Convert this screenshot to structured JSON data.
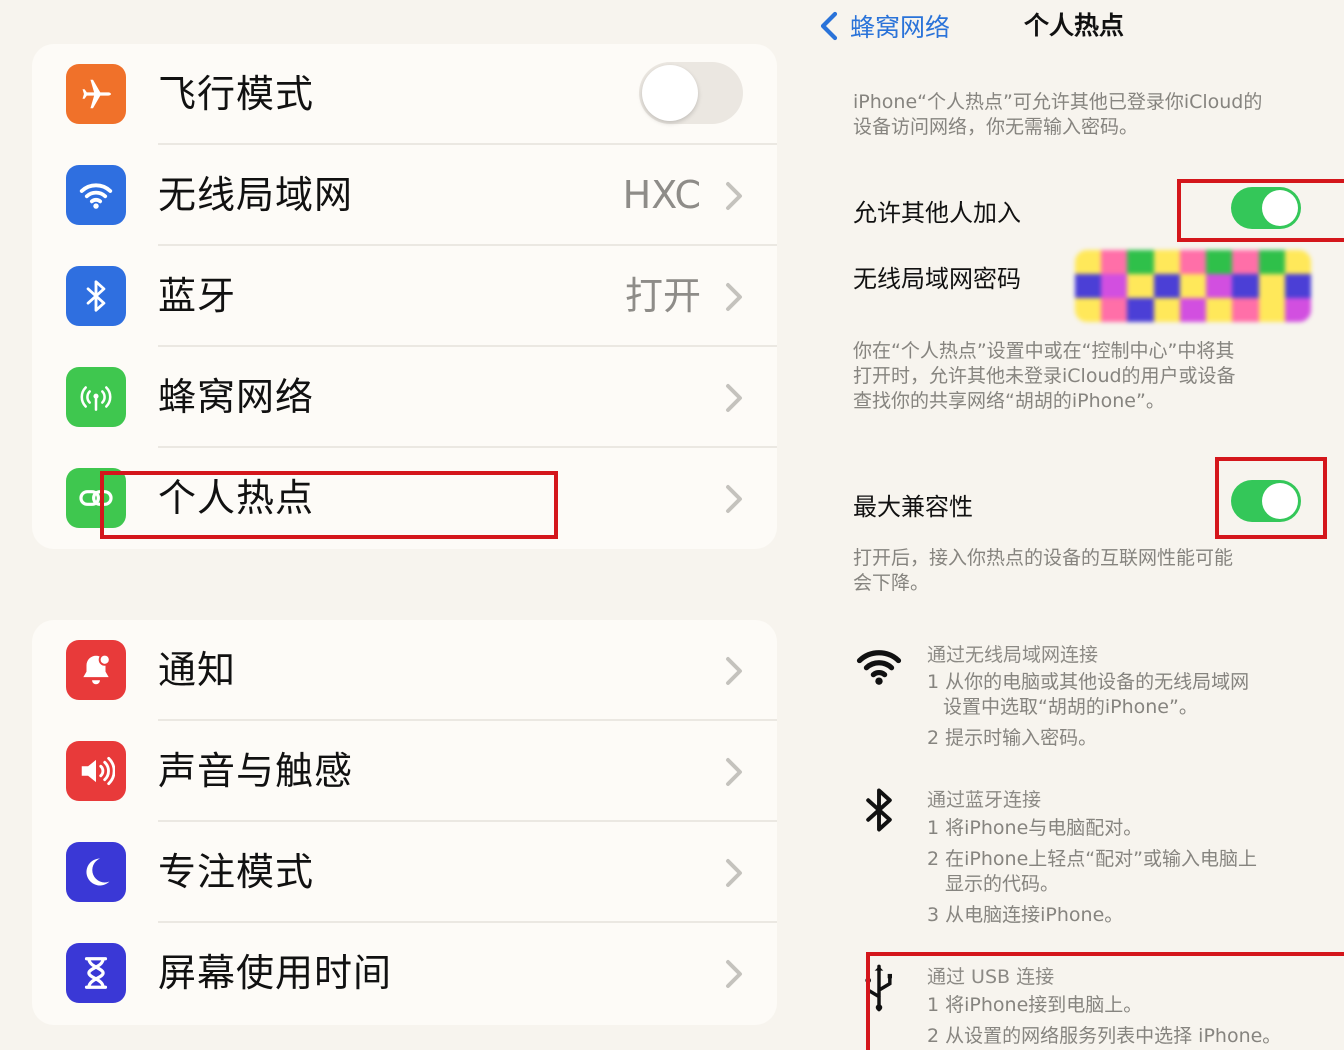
{
  "colors": {
    "airplane": "#f0712a",
    "wifi": "#2f6fe0",
    "bluetooth": "#2f6fe0",
    "cellular": "#3fc74f",
    "hotspot": "#3fc74f",
    "notifications": "#e83a3a",
    "sounds": "#e83a3a",
    "focus": "#3a38d6",
    "screentime": "#3a38d6",
    "toggle_on": "#34c759",
    "link": "#2a73d9",
    "highlight": "#d4161b"
  },
  "settings": {
    "group1": [
      {
        "label": "飞行模式",
        "icon": "airplane-icon",
        "control": "toggle-off"
      },
      {
        "label": "无线局域网",
        "icon": "wifi-icon",
        "value": "HXC"
      },
      {
        "label": "蓝牙",
        "icon": "bluetooth-icon",
        "value": "打开"
      },
      {
        "label": "蜂窝网络",
        "icon": "cellular-icon"
      },
      {
        "label": "个人热点",
        "icon": "hotspot-icon"
      }
    ],
    "group2": [
      {
        "label": "通知",
        "icon": "bell-icon"
      },
      {
        "label": "声音与触感",
        "icon": "speaker-icon"
      },
      {
        "label": "专注模式",
        "icon": "moon-icon"
      },
      {
        "label": "屏幕使用时间",
        "icon": "hourglass-icon"
      }
    ]
  },
  "hotspot": {
    "back_label": "蜂窝网络",
    "title": "个人热点",
    "intro": [
      "iPhone“个人热点”可允许其他已登录你iCloud的",
      "设备访问网络，你无需输入密码。"
    ],
    "allow_label": "允许其他人加入",
    "allow_on": true,
    "password_label": "无线局域网密码",
    "allow_desc": [
      "你在“个人热点”设置中或在“控制中心”中将其",
      "打开时，允许其他未登录iCloud的用户或设备",
      "查找你的共享网络“胡胡的iPhone”。"
    ],
    "max_compat_label": "最大兼容性",
    "max_compat_on": true,
    "max_compat_desc": [
      "打开后，接入你热点的设备的互联网性能可能",
      "会下降。"
    ],
    "wifi_section": {
      "heading": "通过无线局域网连接",
      "step1": [
        "1 从你的电脑或其他设备的无线局域网",
        "设置中选取“胡胡的iPhone”。"
      ],
      "step2": "2 提示时输入密码。"
    },
    "bt_section": {
      "heading": "通过蓝牙连接",
      "step1": "1 将iPhone与电脑配对。",
      "step2": [
        "2 在iPhone上轻点“配对”或输入电脑上",
        "显示的代码。"
      ],
      "step3": "3 从电脑连接iPhone。"
    },
    "usb_section": {
      "heading": "通过 USB 连接",
      "step1": "1 将iPhone接到电脑上。",
      "step2": "2 从设置的网络服务列表中选择 iPhone。"
    }
  }
}
